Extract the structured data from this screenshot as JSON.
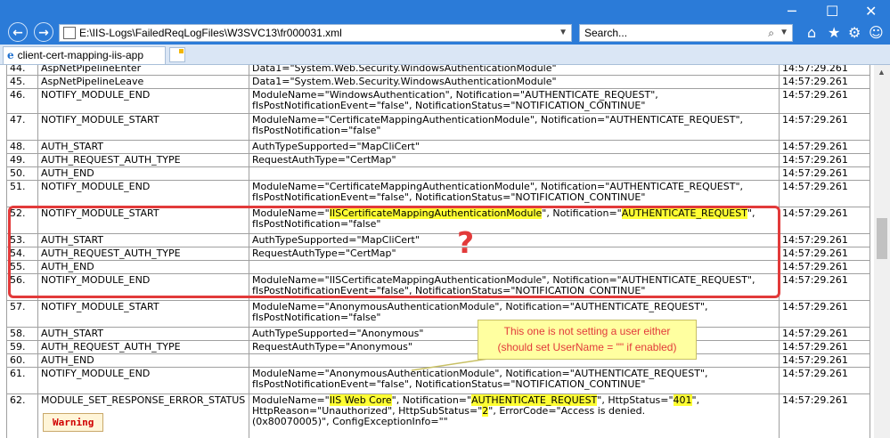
{
  "browser": {
    "address": "E:\\IIS-Logs\\FailedReqLogFiles\\W3SVC13\\fr000031.xml",
    "search_placeholder": "Search...",
    "tab_title": "client-cert-mapping-iis-app"
  },
  "rows": [
    {
      "num": "44.",
      "event": "AspNetPipelineEnter",
      "data": "Data1=\"System.Web.Security.WindowsAuthenticationModule\"",
      "time": "14:57:29.261"
    },
    {
      "num": "45.",
      "event": "AspNetPipelineLeave",
      "data": "Data1=\"System.Web.Security.WindowsAuthenticationModule\"",
      "time": "14:57:29.261"
    },
    {
      "num": "46.",
      "event": "NOTIFY_MODULE_END",
      "data_a": "ModuleName=\"WindowsAuthentication\", Notification=\"AUTHENTICATE_REQUEST\",",
      "data_b": "fIsPostNotificationEvent=\"false\", NotificationStatus=\"NOTIFICATION_CONTINUE\"",
      "time": "14:57:29.261"
    },
    {
      "num": "47.",
      "event": "NOTIFY_MODULE_START",
      "data_a": "ModuleName=\"CertificateMappingAuthenticationModule\", Notification=\"AUTHENTICATE_REQUEST\",",
      "data_b": "fIsPostNotification=\"false\"",
      "time": "14:57:29.261"
    },
    {
      "num": "48.",
      "event": "AUTH_START",
      "data": "AuthTypeSupported=\"MapCliCert\"",
      "time": "14:57:29.261"
    },
    {
      "num": "49.",
      "event": "AUTH_REQUEST_AUTH_TYPE",
      "data": "RequestAuthType=\"CertMap\"",
      "time": "14:57:29.261"
    },
    {
      "num": "50.",
      "event": "AUTH_END",
      "data": "",
      "time": "14:57:29.261"
    },
    {
      "num": "51.",
      "event": "NOTIFY_MODULE_END",
      "data_a": "ModuleName=\"CertificateMappingAuthenticationModule\", Notification=\"AUTHENTICATE_REQUEST\",",
      "data_b": "fIsPostNotificationEvent=\"false\", NotificationStatus=\"NOTIFICATION_CONTINUE\"",
      "time": "14:57:29.261"
    },
    {
      "num": "52.",
      "event": "NOTIFY_MODULE_START",
      "d1": "ModuleName=\"",
      "h1": "IISCertificateMappingAuthenticationModule",
      "d2": "\", Notification=\"",
      "h2": "AUTHENTICATE_REQUEST",
      "d3": "\",",
      "data_b": "fIsPostNotification=\"false\"",
      "time": "14:57:29.261"
    },
    {
      "num": "53.",
      "event": "AUTH_START",
      "data": "AuthTypeSupported=\"MapCliCert\"",
      "time": "14:57:29.261"
    },
    {
      "num": "54.",
      "event": "AUTH_REQUEST_AUTH_TYPE",
      "data": "RequestAuthType=\"CertMap\"",
      "time": "14:57:29.261"
    },
    {
      "num": "55.",
      "event": "AUTH_END",
      "data": "",
      "time": "14:57:29.261"
    },
    {
      "num": "56.",
      "event": "NOTIFY_MODULE_END",
      "data_a": "ModuleName=\"IISCertificateMappingAuthenticationModule\", Notification=\"AUTHENTICATE_REQUEST\",",
      "data_b": "fIsPostNotificationEvent=\"false\", NotificationStatus=\"NOTIFICATION_CONTINUE\"",
      "time": "14:57:29.261"
    },
    {
      "num": "57.",
      "event": "NOTIFY_MODULE_START",
      "data_a": "ModuleName=\"AnonymousAuthenticationModule\", Notification=\"AUTHENTICATE_REQUEST\",",
      "data_b": "fIsPostNotification=\"false\"",
      "time": "14:57:29.261"
    },
    {
      "num": "58.",
      "event": "AUTH_START",
      "data": "AuthTypeSupported=\"Anonymous\"",
      "time": "14:57:29.261"
    },
    {
      "num": "59.",
      "event": "AUTH_REQUEST_AUTH_TYPE",
      "data": "RequestAuthType=\"Anonymous\"",
      "time": "14:57:29.261"
    },
    {
      "num": "60.",
      "event": "AUTH_END",
      "data": "",
      "time": "14:57:29.261"
    },
    {
      "num": "61.",
      "event": "NOTIFY_MODULE_END",
      "data_a": "ModuleName=\"AnonymousAuthenticationModule\", Notification=\"AUTHENTICATE_REQUEST\",",
      "data_b": "fIsPostNotificationEvent=\"false\", NotificationStatus=\"NOTIFICATION_CONTINUE\"",
      "time": "14:57:29.261"
    },
    {
      "num": "62.",
      "event": "MODULE_SET_RESPONSE_ERROR_STATUS",
      "warning": "Warning",
      "d1": "ModuleName=\"",
      "h1": "IIS Web Core",
      "d2": "\", Notification=\"",
      "h2": "AUTHENTICATE_REQUEST",
      "d3": "\", HttpStatus=\"",
      "h3": "401",
      "d4": "\",",
      "e1": "HttpReason=\"Unauthorized\", HttpSubStatus=\"",
      "h4": "2",
      "e2": "\", ErrorCode=\"Access is denied.",
      "data_c": "(0x80070005)\", ConfigExceptionInfo=\"\"",
      "time": "14:57:29.261"
    }
  ],
  "annotation": {
    "question_mark": "?",
    "callout_line1": "This one is not setting a user either",
    "callout_line2": "(should set UserName = \"\" if enabled)",
    "highlight_color": "#ffff33",
    "annotation_color": "#e23a3a"
  }
}
